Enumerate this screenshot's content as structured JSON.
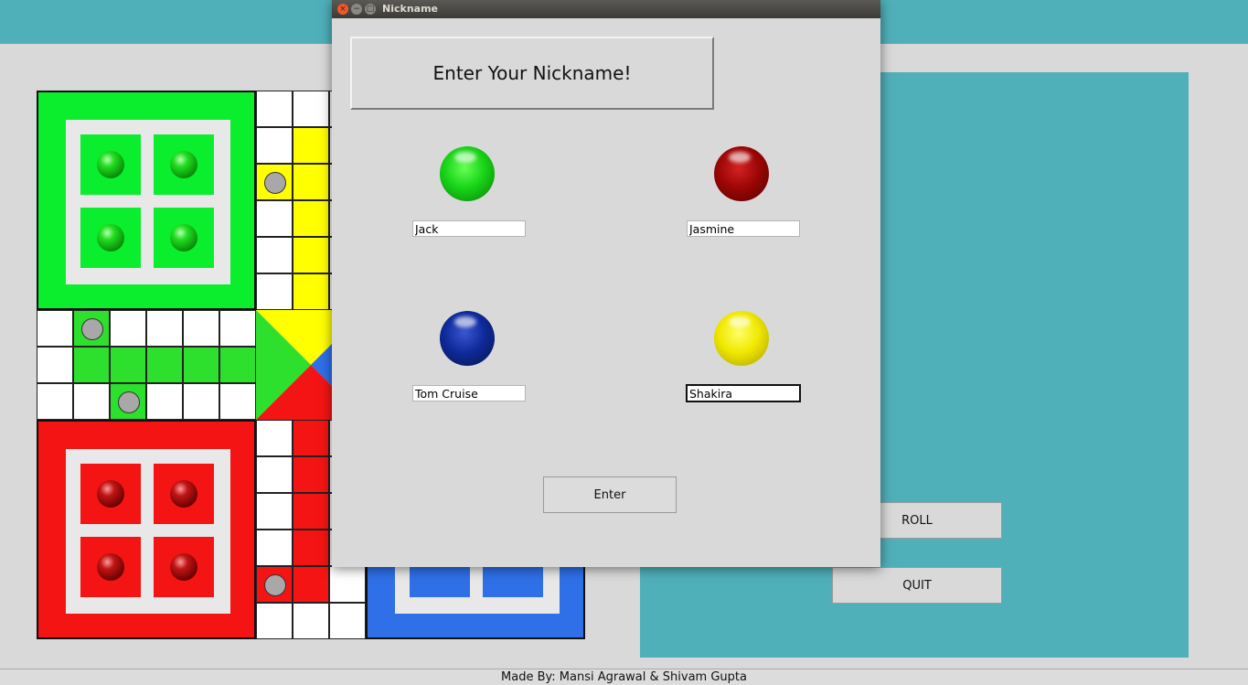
{
  "colors": {
    "teal": "#4fb0ba",
    "green": "#0aee2e",
    "yellow": "#ffff00",
    "red": "#f41414",
    "blue": "#2f6fe8",
    "light_green": "#2de02d"
  },
  "controls": {
    "roll_label": "ROLL",
    "quit_label": "QUIT"
  },
  "footer": {
    "credits": "Made By: Mansi Agrawal & Shivam Gupta"
  },
  "dialog": {
    "window_title": "Nickname",
    "heading": "Enter Your Nickname!",
    "players": [
      {
        "color": "green",
        "nickname": "Jack"
      },
      {
        "color": "red",
        "nickname": "Jasmine"
      },
      {
        "color": "blue",
        "nickname": "Tom Cruise"
      },
      {
        "color": "yellow",
        "nickname": "Shakira"
      }
    ],
    "enter_label": "Enter"
  }
}
